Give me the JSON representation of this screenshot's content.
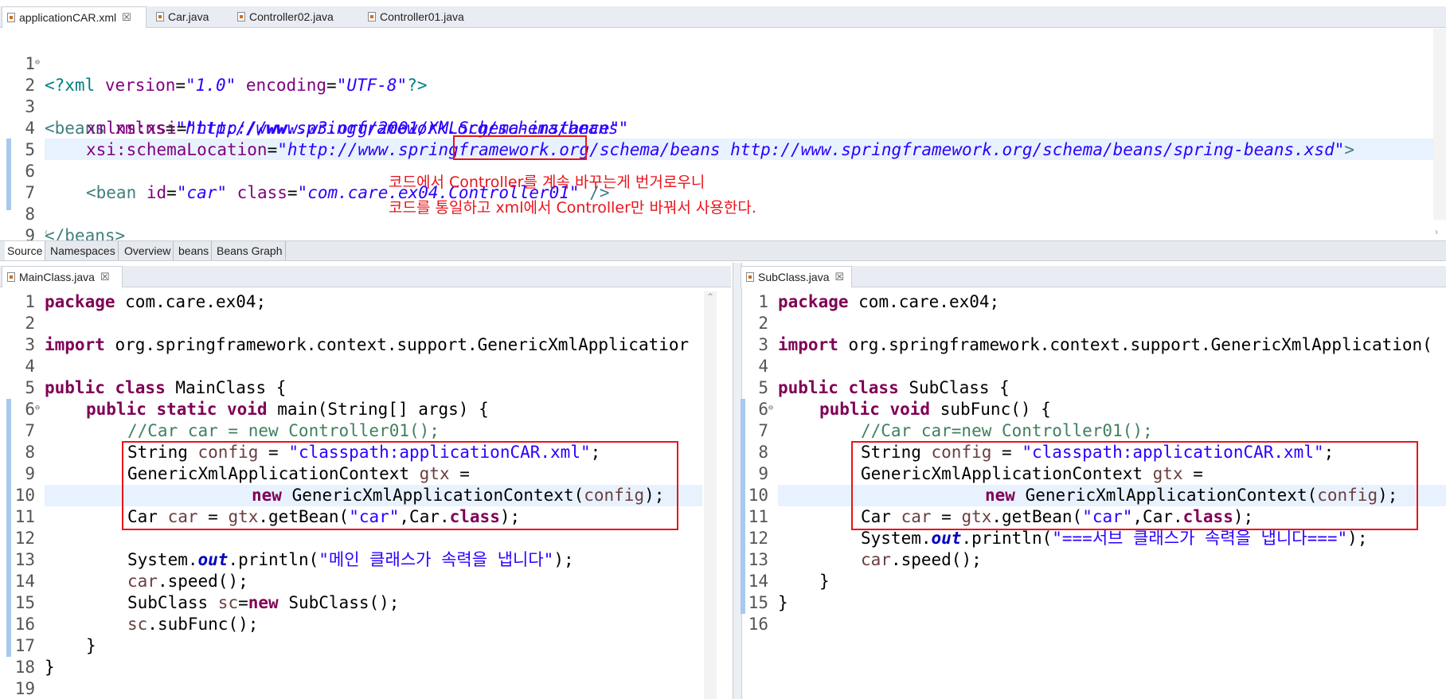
{
  "top_tabs": [
    {
      "label": "applicationCAR.xml",
      "close": "☒",
      "active": true
    },
    {
      "label": "Car.java",
      "close": "",
      "active": false
    },
    {
      "label": "Controller02.java",
      "close": "",
      "active": false
    },
    {
      "label": "Controller01.java",
      "close": "",
      "active": false
    }
  ],
  "xml": {
    "lines": [
      {
        "n": "1"
      },
      {
        "n": "2"
      },
      {
        "n": "3"
      },
      {
        "n": "4"
      },
      {
        "n": "5"
      },
      {
        "n": "6"
      },
      {
        "n": "7"
      },
      {
        "n": "8"
      },
      {
        "n": "9"
      }
    ],
    "l1_a": "<?xml ",
    "l1_b": "version",
    "l1_c": "=",
    "l1_d": "\"1.0\"",
    "l1_e": " encoding",
    "l1_f": "=",
    "l1_g": "\"UTF-8\"",
    "l1_h": "?>",
    "l2_a": "<beans ",
    "l2_b": "xmlns",
    "l2_c": "=",
    "l2_d": "\"http://www.springframework.org/schema/beans\"",
    "l3_b": "xmlns:xsi",
    "l3_c": "=",
    "l3_d": "\"http://www.w3.org/2001/XMLSchema-instance\"",
    "l4_b": "xsi:schemaLocation",
    "l4_c": "=",
    "l4_d": "\"http://www.springframework.org/schema/beans http://www.springframework.org/schema/beans/spring-beans.xsd\"",
    "l4_e": ">",
    "l6_a": "<bean ",
    "l6_b": "id",
    "l6_c": "=",
    "l6_d": "\"car\"",
    "l6_e": " class",
    "l6_f": "=",
    "l6_g": "\"com.care.ex04.",
    "l6_h": "Controller01",
    "l6_i": "\"",
    "l6_j": " />",
    "l8_a": "</beans>",
    "annotation_1": "코드에서 Controller를 계속 바꾸는게 번거로우니",
    "annotation_2": "코드를 통일하고 xml에서 Controller만 바꿔서 사용한다."
  },
  "bottom_tabs": [
    "Source",
    "Namespaces",
    "Overview",
    "beans",
    "Beans Graph"
  ],
  "left_editor": {
    "tab": "MainClass.java",
    "close": "☒",
    "line_numbers": [
      "1",
      "2",
      "3",
      "4",
      "5",
      "6",
      "7",
      "8",
      "9",
      "10",
      "11",
      "12",
      "13",
      "14",
      "15",
      "16",
      "17",
      "18",
      "19"
    ],
    "c1_kw": "package",
    "c1_rest": " com.care.ex04;",
    "c3_kw": "import",
    "c3_rest": " org.springframework.context.support.GenericXmlApplicatior",
    "c5_kw": "public class",
    "c5_rest": " MainClass {",
    "c6_kw": "public static void",
    "c6_rest": " main(String[] args) {",
    "c7": "//Car car = new Controller01();",
    "c8_a": "String ",
    "c8_b": "config",
    "c8_c": " = ",
    "c8_d": "\"classpath:applicationCAR.xml\"",
    "c8_e": ";",
    "c9_a": "GenericXmlApplicationContext ",
    "c9_b": "gtx",
    "c9_c": " =",
    "c10_kw": "new",
    "c10_a": " GenericXmlApplicationContext(",
    "c10_b": "config",
    "c10_c": ");",
    "c11_a": "Car ",
    "c11_b": "car",
    "c11_c": " = ",
    "c11_d": "gtx",
    "c11_e": ".getBean(",
    "c11_f": "\"car\"",
    "c11_g": ",Car.",
    "c11_kw": "class",
    "c11_h": ");",
    "c13_a": "System.",
    "c13_b": "out",
    "c13_c": ".println(",
    "c13_d": "\"메인 클래스가 속력을 냅니다\"",
    "c13_e": ");",
    "c14_a": "car",
    "c14_b": ".speed();",
    "c15_a": "SubClass ",
    "c15_b": "sc",
    "c15_c": "=",
    "c15_kw": "new",
    "c15_d": " SubClass();",
    "c16_a": "sc",
    "c16_b": ".subFunc();",
    "c17": "}",
    "c18": "}"
  },
  "right_editor": {
    "tab": "SubClass.java",
    "close": "☒",
    "line_numbers": [
      "1",
      "2",
      "3",
      "4",
      "5",
      "6",
      "7",
      "8",
      "9",
      "10",
      "11",
      "12",
      "13",
      "14",
      "15",
      "16"
    ],
    "c1_kw": "package",
    "c1_rest": " com.care.ex04;",
    "c3_kw": "import",
    "c3_rest": " org.springframework.context.support.GenericXmlApplication(",
    "c5_kw": "public class",
    "c5_rest": " SubClass {",
    "c6_kw": "public void",
    "c6_rest": " subFunc() {",
    "c7": "//Car car=new Controller01();",
    "c8_a": "String ",
    "c8_b": "config",
    "c8_c": " = ",
    "c8_d": "\"classpath:applicationCAR.xml\"",
    "c8_e": ";",
    "c9_a": "GenericXmlApplicationContext ",
    "c9_b": "gtx",
    "c9_c": " =",
    "c10_kw": "new",
    "c10_a": " GenericXmlApplicationContext(",
    "c10_b": "config",
    "c10_c": ");",
    "c11_a": "Car ",
    "c11_b": "car",
    "c11_c": " = ",
    "c11_d": "gtx",
    "c11_e": ".getBean(",
    "c11_f": "\"car\"",
    "c11_g": ",Car.",
    "c11_kw": "class",
    "c11_h": ");",
    "c12_a": "System.",
    "c12_b": "out",
    "c12_c": ".println(",
    "c12_d": "\"===서브 클래스가 속력을 냅니다===\"",
    "c12_e": ");",
    "c13_a": "car",
    "c13_b": ".speed();",
    "c14": "}",
    "c15": "}"
  },
  "colors": {
    "keyword": "#7f0055",
    "string": "#2a00ff",
    "comment": "#3f7f5f",
    "annotation": "#e8141c",
    "highlight_line": "#e8f2fe"
  }
}
